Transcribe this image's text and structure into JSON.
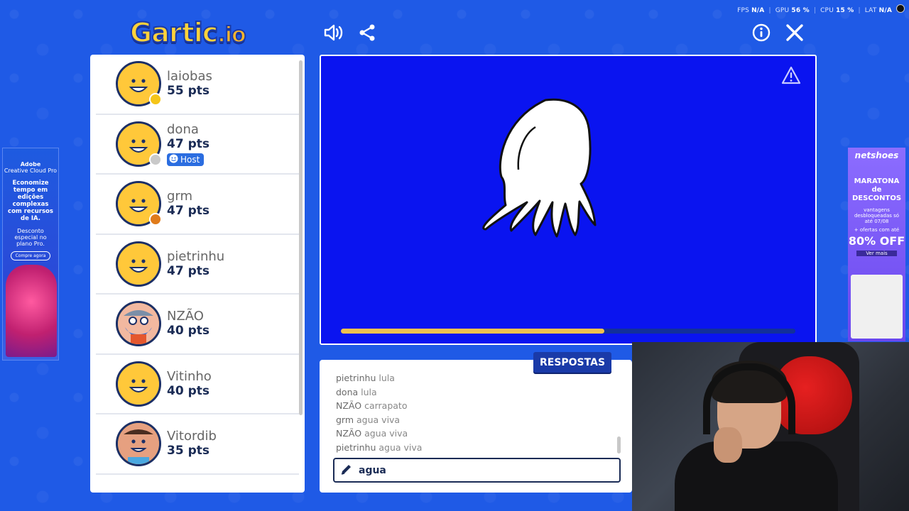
{
  "stats": {
    "fps_label": "FPS",
    "fps_value": "N/A",
    "gpu_label": "GPU",
    "gpu_value": "56 %",
    "cpu_label": "CPU",
    "cpu_value": "15 %",
    "lat_label": "LAT",
    "lat_value": "N/A"
  },
  "header": {
    "logo_main": "Gartic",
    "logo_suffix": ".io",
    "icons": [
      "sound-icon",
      "share-icon",
      "info-icon",
      "close-icon"
    ]
  },
  "players": [
    {
      "name": "laiobas",
      "points": "55 pts",
      "status_color": "#f5c518",
      "avatar_color": "#ffc83a"
    },
    {
      "name": "dona",
      "points": "47 pts",
      "status_color": "#c9c9c9",
      "host_label": "Host",
      "avatar_color": "#ffc83a"
    },
    {
      "name": "grm",
      "points": "47 pts",
      "status_color": "#e07b1a",
      "avatar_color": "#ffc83a"
    },
    {
      "name": "pietrinhu",
      "points": "47 pts",
      "avatar_color": "#ffc83a"
    },
    {
      "name": "NZÃO",
      "points": "40 pts",
      "avatar_color": "#f2b8a0"
    },
    {
      "name": "Vitinho",
      "points": "40 pts",
      "avatar_color": "#ffc83a"
    },
    {
      "name": "Vitordib",
      "points": "35 pts",
      "avatar_color": "#e6a080"
    }
  ],
  "ads": {
    "left": {
      "brand": "Adobe",
      "product": "Creative Cloud Pro",
      "headline": "Economize tempo em edições complexas com recursos de IA.",
      "sub": "Desconto especial no plano Pro.",
      "cta": "Compre agora"
    },
    "right": {
      "brand": "netshoes",
      "headline": "MARATONA de DESCONTOS",
      "sub": "vantagens desbloqueadas só até 07/08",
      "offer_prefix": "+ ofertas com até",
      "offer": "80% OFF",
      "cta": "Ver mais"
    }
  },
  "canvas": {
    "background": "#0a14f0",
    "progress_fraction": 0.58
  },
  "answers": {
    "title": "RESPOSTAS",
    "messages": [
      {
        "user": "pietrinhu",
        "text": "lula"
      },
      {
        "user": "dona",
        "text": "lula"
      },
      {
        "user": "NZÃO",
        "text": "carrapato"
      },
      {
        "user": "grm",
        "text": "agua viva"
      },
      {
        "user": "NZÃO",
        "text": "agua viva"
      },
      {
        "user": "pietrinhu",
        "text": "agua viva"
      }
    ],
    "input_value": "agua "
  }
}
